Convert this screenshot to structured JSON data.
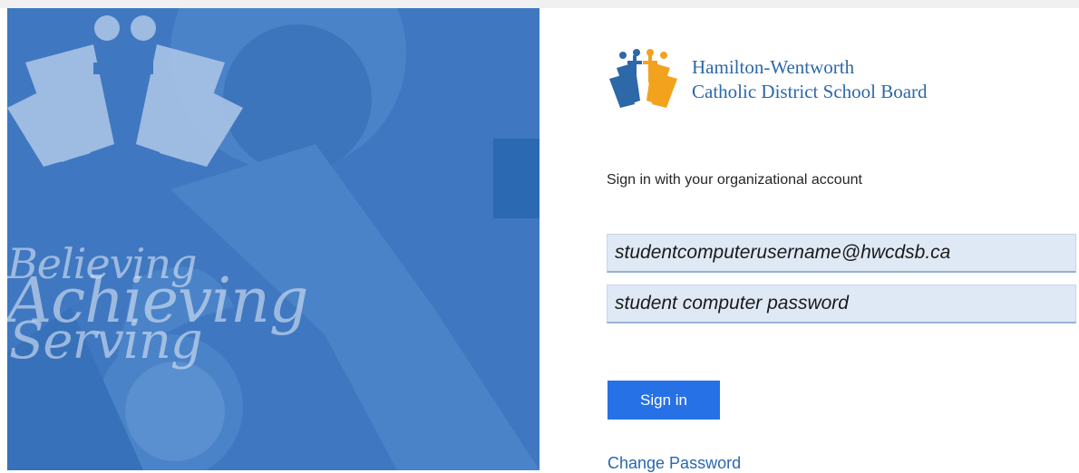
{
  "org": {
    "name_line1": "Hamilton-Wentworth",
    "name_line2": "Catholic District School Board"
  },
  "illustration": {
    "tagline": [
      "Believing",
      "Achieving",
      "Serving"
    ]
  },
  "form": {
    "prompt": "Sign in with your organizational account",
    "username_value": "studentcomputerusername@hwcdsb.ca",
    "password_value": "student computer password",
    "signin_label": "Sign in",
    "change_password_label": "Change Password"
  },
  "colors": {
    "panel_blue": "#3f78c0",
    "button_blue": "#2671e6",
    "field_bg": "#dfe9f5",
    "logo_blue": "#2d68a8",
    "logo_orange": "#f3a21d"
  }
}
